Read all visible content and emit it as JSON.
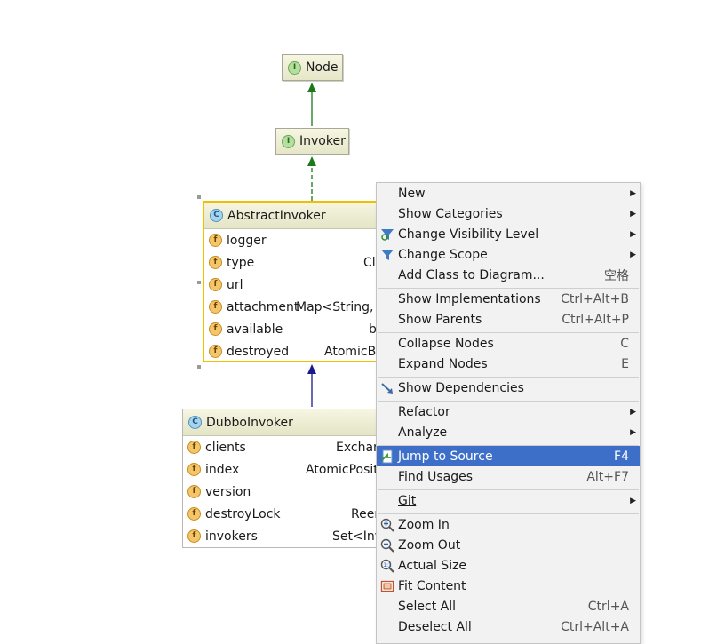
{
  "diagram": {
    "node_interface_1": {
      "name": "Node",
      "badge": "I"
    },
    "node_interface_2": {
      "name": "Invoker",
      "badge": "I"
    },
    "abstract_class": {
      "name": "AbstractInvoker",
      "badge": "C",
      "fields": [
        {
          "name": "logger",
          "type": ""
        },
        {
          "name": "type",
          "type": "Cl"
        },
        {
          "name": "url",
          "type": ""
        },
        {
          "name": "attachment",
          "type": "Map<String, S"
        },
        {
          "name": "available",
          "type": "b"
        },
        {
          "name": "destroyed",
          "type": "AtomicBo"
        }
      ]
    },
    "dubbo_class": {
      "name": "DubboInvoker",
      "badge": "C",
      "fields": [
        {
          "name": "clients",
          "type": "Exchan"
        },
        {
          "name": "index",
          "type": "AtomicPosit"
        },
        {
          "name": "version",
          "type": ""
        },
        {
          "name": "destroyLock",
          "type": "Reen"
        },
        {
          "name": "invokers",
          "type": "Set<Inv"
        }
      ]
    },
    "field_badge": "f",
    "colors": {
      "extends_arrow": "#1a7a1a",
      "implements_arrow": "#1a7a1a",
      "inherit_arrow": "#1a1a8c",
      "selection_border": "#f0c000",
      "menu_highlight": "#3d6fc9"
    }
  },
  "context_menu": {
    "items": [
      {
        "id": "new",
        "label": "New",
        "shortcut": "",
        "submenu": true
      },
      {
        "id": "show_categories",
        "label": "Show Categories",
        "shortcut": "",
        "submenu": true
      },
      {
        "id": "change_visibility",
        "label": "Change Visibility Level",
        "shortcut": "",
        "submenu": true,
        "icon": "visibility-funnel-icon"
      },
      {
        "id": "change_scope",
        "label": "Change Scope",
        "shortcut": "",
        "submenu": true,
        "icon": "filter-icon"
      },
      {
        "id": "add_class",
        "label": "Add Class to Diagram...",
        "shortcut": "空格",
        "submenu": false
      },
      {
        "id": "show_impl",
        "label": "Show Implementations",
        "shortcut": "Ctrl+Alt+B",
        "submenu": false
      },
      {
        "id": "show_parents",
        "label": "Show Parents",
        "shortcut": "Ctrl+Alt+P",
        "submenu": false
      },
      {
        "id": "collapse",
        "label": "Collapse Nodes",
        "shortcut": "C",
        "submenu": false
      },
      {
        "id": "expand",
        "label": "Expand Nodes",
        "shortcut": "E",
        "submenu": false
      },
      {
        "id": "show_deps",
        "label": "Show Dependencies",
        "shortcut": "",
        "submenu": false,
        "icon": "dependency-arrow-icon"
      },
      {
        "id": "refactor",
        "label": "Refactor",
        "shortcut": "",
        "submenu": true
      },
      {
        "id": "analyze",
        "label": "Analyze",
        "shortcut": "",
        "submenu": true
      },
      {
        "id": "jump_source",
        "label": "Jump to Source",
        "shortcut": "F4",
        "submenu": false,
        "icon": "jump-source-icon",
        "selected": true
      },
      {
        "id": "find_usages",
        "label": "Find Usages",
        "shortcut": "Alt+F7",
        "submenu": false
      },
      {
        "id": "git",
        "label": "Git",
        "shortcut": "",
        "submenu": true
      },
      {
        "id": "zoom_in",
        "label": "Zoom In",
        "shortcut": "",
        "submenu": false,
        "icon": "zoom-in-icon"
      },
      {
        "id": "zoom_out",
        "label": "Zoom Out",
        "shortcut": "",
        "submenu": false,
        "icon": "zoom-out-icon"
      },
      {
        "id": "actual_size",
        "label": "Actual Size",
        "shortcut": "",
        "submenu": false,
        "icon": "actual-size-icon"
      },
      {
        "id": "fit_content",
        "label": "Fit Content",
        "shortcut": "",
        "submenu": false,
        "icon": "fit-content-icon"
      },
      {
        "id": "select_all",
        "label": "Select All",
        "shortcut": "Ctrl+A",
        "submenu": false
      },
      {
        "id": "deselect_all",
        "label": "Deselect All",
        "shortcut": "Ctrl+Alt+A",
        "submenu": false
      }
    ]
  }
}
